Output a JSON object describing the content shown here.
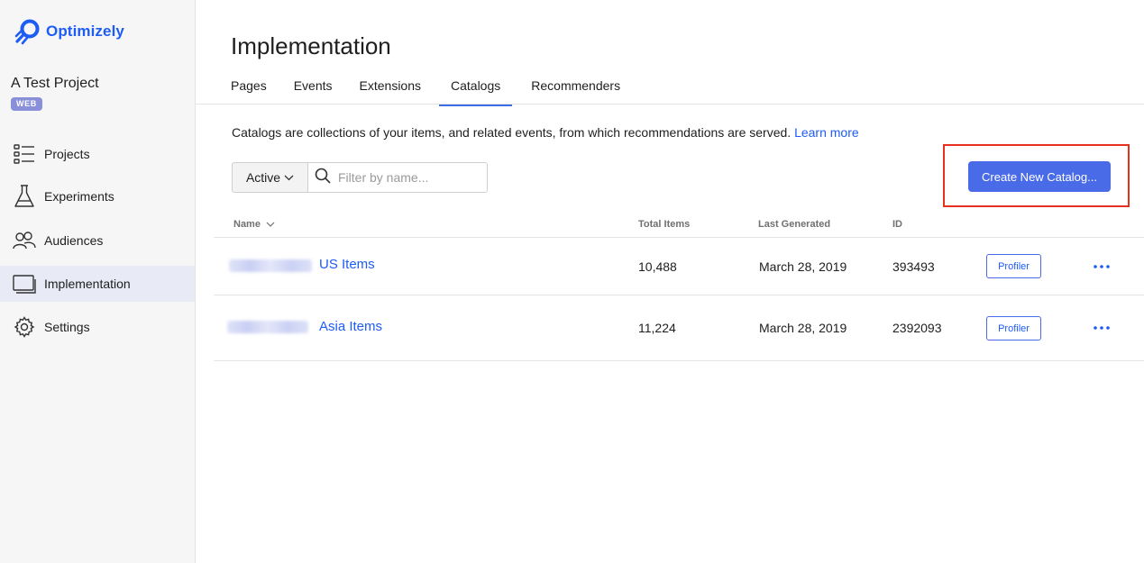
{
  "brand": {
    "name": "Optimizely",
    "color": "#1d5cf5"
  },
  "project": {
    "name": "A Test Project",
    "badge": "WEB"
  },
  "sidebar": {
    "items": [
      {
        "label": "Projects",
        "icon": "list-icon"
      },
      {
        "label": "Experiments",
        "icon": "flask-icon"
      },
      {
        "label": "Audiences",
        "icon": "audience-icon"
      },
      {
        "label": "Implementation",
        "icon": "monitor-icon",
        "active": true
      },
      {
        "label": "Settings",
        "icon": "gear-icon"
      }
    ]
  },
  "page": {
    "title": "Implementation"
  },
  "tabs": [
    {
      "label": "Pages"
    },
    {
      "label": "Events"
    },
    {
      "label": "Extensions"
    },
    {
      "label": "Catalogs",
      "active": true
    },
    {
      "label": "Recommenders"
    }
  ],
  "description": {
    "text": "Catalogs are collections of your items, and related events, from which recommendations are served.",
    "link": "Learn more"
  },
  "filter": {
    "status": "Active",
    "search_placeholder": "Filter by name..."
  },
  "create_button": "Create New Catalog...",
  "table": {
    "columns": {
      "name": "Name",
      "total": "Total Items",
      "generated": "Last Generated",
      "id": "ID"
    },
    "rows": [
      {
        "name": "US Items",
        "total": "10,488",
        "generated": "March 28, 2019",
        "id": "393493",
        "action": "Profiler"
      },
      {
        "name": "Asia Items",
        "total": "11,224",
        "generated": "March 28, 2019",
        "id": "2392093",
        "action": "Profiler"
      }
    ]
  },
  "colors": {
    "accent": "#4a6be8",
    "highlight": "#e8301f",
    "sidebar_active": "#e8ebf6"
  }
}
